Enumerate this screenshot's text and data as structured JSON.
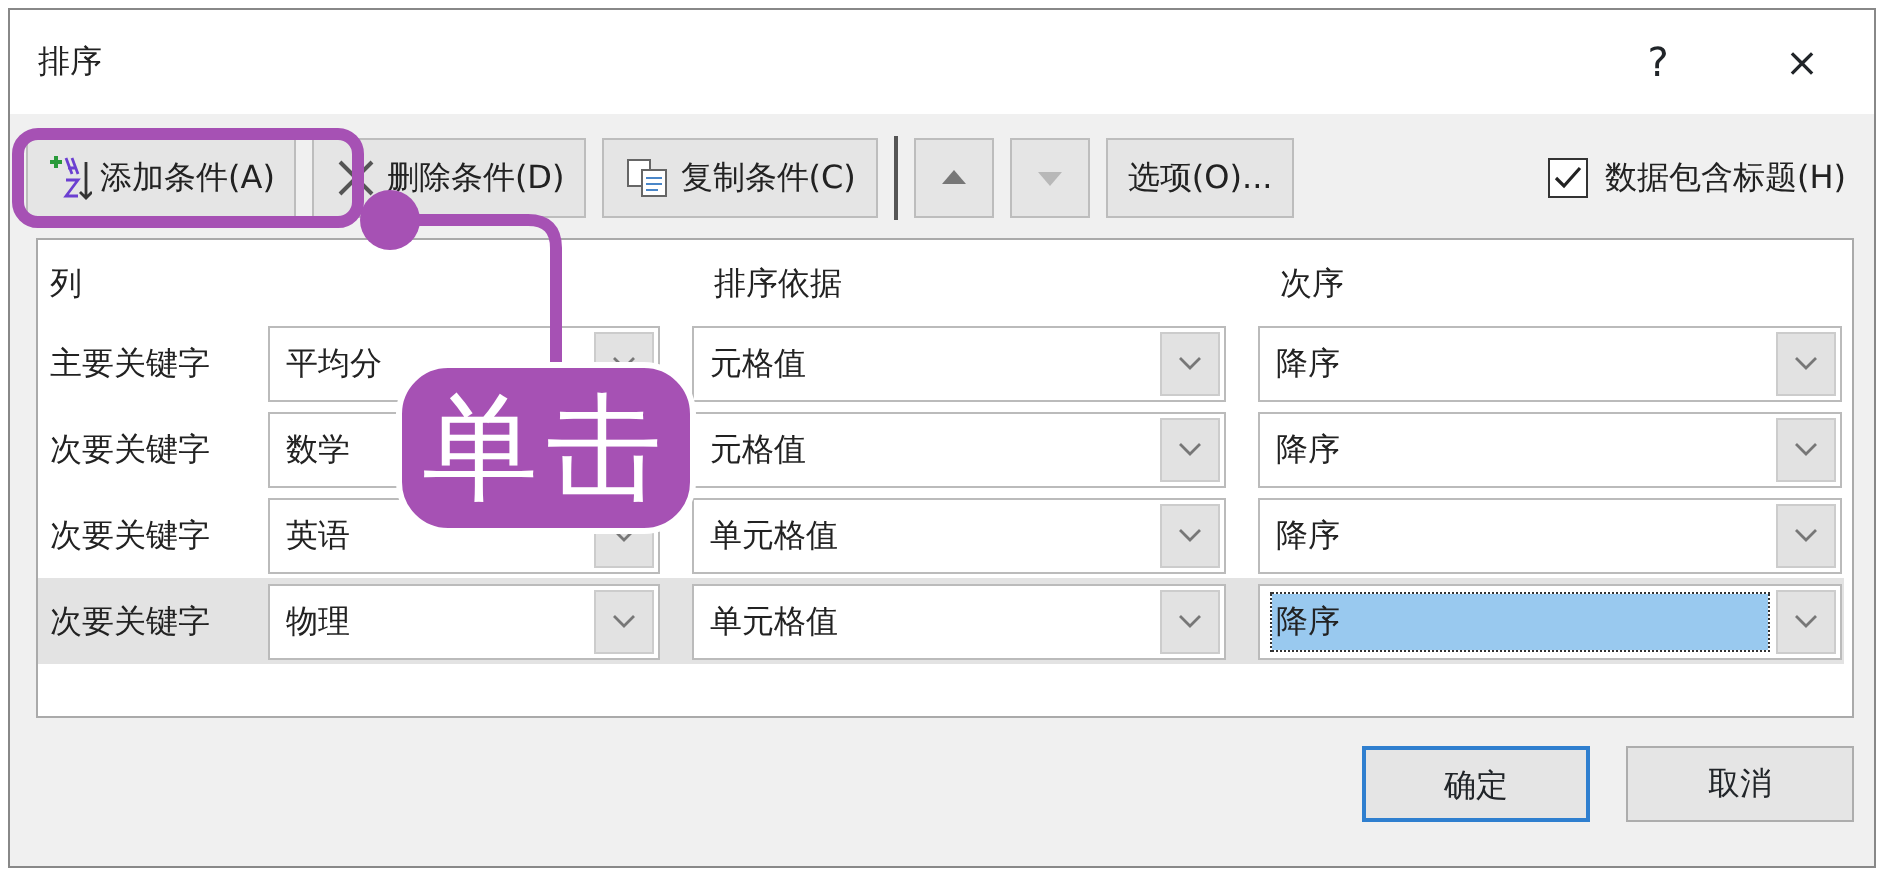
{
  "window": {
    "title": "排序",
    "help": "?",
    "close": "×"
  },
  "toolbar": {
    "buttons": [
      {
        "kind": "add",
        "label": "添加条件(A)"
      },
      {
        "kind": "delete",
        "label": "删除条件(D)"
      },
      {
        "kind": "copy",
        "label": "复制条件(C)"
      }
    ],
    "move_up": {
      "disabled": false
    },
    "move_down": {
      "disabled": true
    },
    "options": "选项(O)...",
    "header_checkbox": {
      "label": "数据包含标题(H)",
      "checked": true
    }
  },
  "columns": [
    "列",
    "排序依据",
    "次序"
  ],
  "rows": [
    {
      "label": "主要关键字",
      "column": "平均分",
      "sort_on": "元格值",
      "order": "降序",
      "selected": false
    },
    {
      "label": "次要关键字",
      "column": "数学",
      "sort_on": "元格值",
      "order": "降序",
      "selected": false
    },
    {
      "label": "次要关键字",
      "column": "英语",
      "sort_on": "单元格值",
      "order": "降序",
      "selected": false
    },
    {
      "label": "次要关键字",
      "column": "物理",
      "sort_on": "单元格值",
      "order": "降序",
      "selected": true
    }
  ],
  "buttons": [
    {
      "label": "确定",
      "default": true
    },
    {
      "label": "取消",
      "default": false
    }
  ],
  "callout": {
    "text": "单击"
  }
}
